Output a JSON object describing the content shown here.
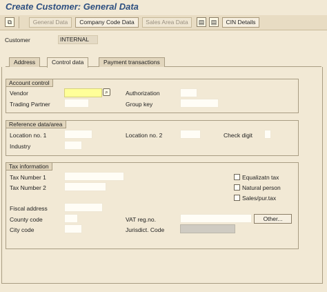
{
  "window": {
    "title": "Create Customer: General Data"
  },
  "toolbar": {
    "icon_left": "⧉",
    "general_data": "General Data",
    "company_code_data": "Company Code Data",
    "sales_area_data": "Sales Area Data",
    "icon_1": "▤",
    "icon_2": "▤",
    "cin_details": "CIN Details"
  },
  "header": {
    "customer_label": "Customer",
    "customer_value": "INTERNAL"
  },
  "tabs": [
    {
      "label": "Address"
    },
    {
      "label": "Control data"
    },
    {
      "label": "Payment transactions"
    }
  ],
  "account_control": {
    "title": "Account control",
    "vendor_label": "Vendor",
    "vendor_value": "",
    "authorization_label": "Authorization",
    "trading_partner_label": "Trading Partner",
    "group_key_label": "Group key"
  },
  "reference_data": {
    "title": "Reference data/area",
    "location_no1_label": "Location no. 1",
    "location_no2_label": "Location no. 2",
    "check_digit_label": "Check digit",
    "industry_label": "Industry"
  },
  "tax_information": {
    "title": "Tax information",
    "tax_number1_label": "Tax Number 1",
    "tax_number2_label": "Tax Number 2",
    "equalization_tax_label": "Equalizatn tax",
    "natural_person_label": "Natural person",
    "sales_pur_tax_label": "Sales/pur.tax",
    "fiscal_address_label": "Fiscal address",
    "county_code_label": "County code",
    "vat_reg_no_label": "VAT reg.no.",
    "other_button": "Other...",
    "city_code_label": "City code",
    "jurisdict_code_label": "Jurisdict. Code"
  },
  "colors": {
    "title": "#2d4f80",
    "background": "#f2e9d5",
    "active_field": "#ffff99"
  }
}
